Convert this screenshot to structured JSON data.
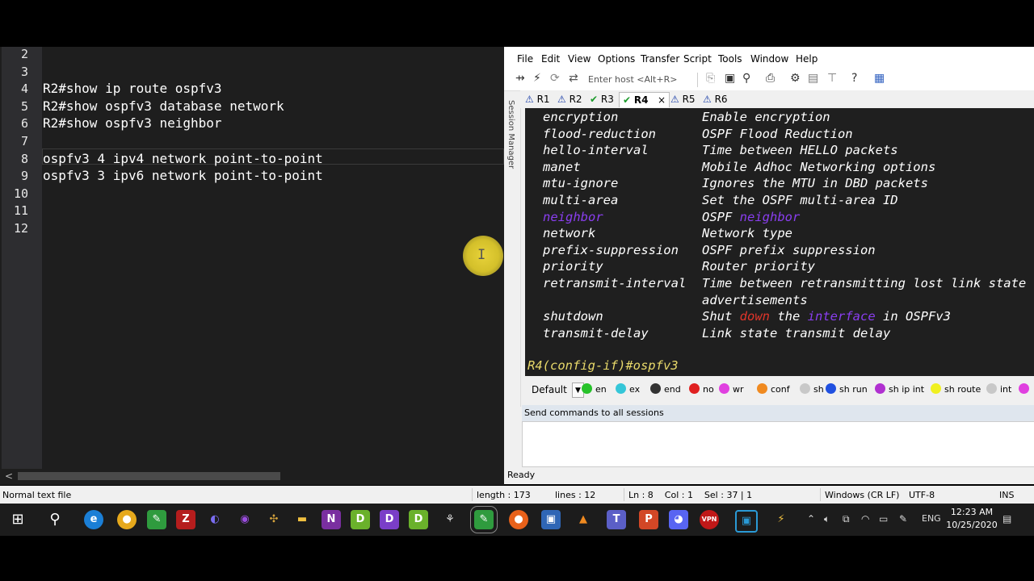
{
  "editor": {
    "line_numbers": [
      "2",
      "3",
      "4",
      "5",
      "6",
      "7",
      "8",
      "9",
      "10",
      "11",
      "12"
    ],
    "lines": [
      "",
      "",
      "R2#show ip route ospfv3",
      "R2#show ospfv3 database network",
      "R2#show ospfv3 neighbor",
      "",
      "ospfv3 4 ipv4 network point-to-point",
      "ospfv3 3 ipv6 network point-to-point",
      "",
      "",
      ""
    ],
    "hscroll_left": "<"
  },
  "cursor_icon": "I",
  "crt": {
    "menu": [
      "File",
      "Edit",
      "View",
      "Options",
      "Transfer",
      "Script",
      "Tools",
      "Window",
      "Help"
    ],
    "host_placeholder": "Enter host <Alt+R>",
    "session_manager": "Session Manager",
    "tabs": [
      {
        "label": "R1",
        "status": "warn"
      },
      {
        "label": "R2",
        "status": "warn"
      },
      {
        "label": "R3",
        "status": "ok"
      },
      {
        "label": "R4",
        "status": "ok",
        "active": true,
        "close": "×"
      },
      {
        "label": "R5",
        "status": "warn"
      },
      {
        "label": "R6",
        "status": "warn"
      }
    ],
    "terminal": {
      "rows": [
        {
          "cmd": "encryption",
          "desc": "Enable encryption"
        },
        {
          "cmd": "flood-reduction",
          "desc": "OSPF Flood Reduction"
        },
        {
          "cmd": "hello-interval",
          "desc": "Time between HELLO packets"
        },
        {
          "cmd": "manet",
          "desc": "Mobile Adhoc Networking options"
        },
        {
          "cmd": "mtu-ignore",
          "desc": "Ignores the MTU in DBD packets"
        },
        {
          "cmd": "multi-area",
          "desc": "Set the OSPF multi-area ID"
        },
        {
          "cmd": "neighbor",
          "desc_a": "OSPF ",
          "desc_b": "neighbor"
        },
        {
          "cmd": "network",
          "desc": "Network type"
        },
        {
          "cmd": "prefix-suppression",
          "desc": "OSPF prefix suppression"
        },
        {
          "cmd": "priority",
          "desc": "Router priority"
        },
        {
          "cmd": "retransmit-interval",
          "desc": "Time between retransmitting lost link state",
          "desc2": "advertisements"
        },
        {
          "cmd": "shutdown",
          "desc_a": "Shut ",
          "desc_red": "down",
          "desc_mid": " the ",
          "desc_purple": "interface",
          "desc_end": " in OSPFv3"
        },
        {
          "cmd": "transmit-delay",
          "desc": "Link state transmit delay"
        }
      ],
      "prompt": "R4(config-if)#ospfv3"
    },
    "button_bar": {
      "selector": "Default",
      "buttons": [
        {
          "label": "en",
          "color": "#27c22a"
        },
        {
          "label": "ex",
          "color": "#35c6d8"
        },
        {
          "label": "end",
          "color": "#333333"
        },
        {
          "label": "no",
          "color": "#e02020"
        },
        {
          "label": "wr",
          "color": "#e040e0"
        },
        {
          "label": "conf",
          "color": "#f08a20"
        },
        {
          "label": "sh",
          "color": "#c8c8c8"
        },
        {
          "label": "sh run",
          "color": "#2050e0"
        },
        {
          "label": "sh ip int",
          "color": "#b030d0"
        },
        {
          "label": "sh route",
          "color": "#f0f020"
        },
        {
          "label": "int",
          "color": "#c8c8c8"
        },
        {
          "label": "",
          "color": "#e040e0"
        }
      ]
    },
    "send_label": "Send commands to all sessions",
    "status": "Ready"
  },
  "npp_status": {
    "type": "Normal text file",
    "length": "length : 173",
    "lines": "lines : 12",
    "pos": "Ln : 8    Col : 1    Sel : 37 | 1",
    "eol": "Windows (CR LF)",
    "enc": "UTF-8",
    "mode": "INS"
  },
  "taskbar": {
    "lang": "ENG",
    "time": "12:23 AM",
    "date": "10/25/2020"
  }
}
